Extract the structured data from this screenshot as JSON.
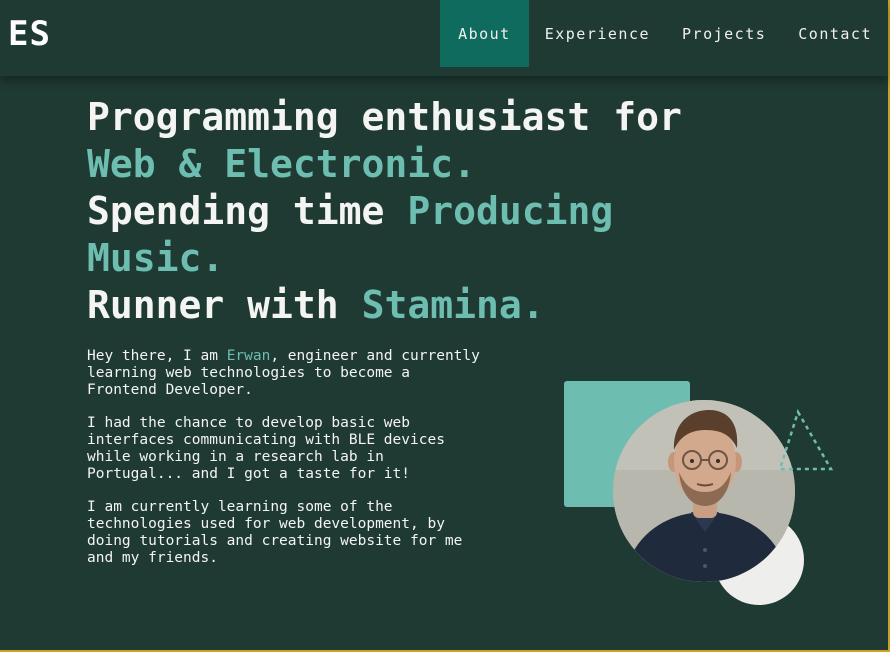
{
  "header": {
    "logo": "ES",
    "nav": [
      {
        "label": "About",
        "active": true
      },
      {
        "label": "Experience",
        "active": false
      },
      {
        "label": "Projects",
        "active": false
      },
      {
        "label": "Contact",
        "active": false
      }
    ]
  },
  "hero": {
    "line1": "Programming enthusiast for",
    "line2_accent": "Web & Electronic.",
    "line3_plain": "Spending time",
    "line3_accent": "Producing",
    "line4_accent": "Music.",
    "line5_plain": "Runner with",
    "line5_accent": "Stamina."
  },
  "intro": {
    "p1_before": "Hey there, I am",
    "p1_name": "Erwan",
    "p1_after": ", engineer and currently learning web technologies to become a Frontend Developer.",
    "p2": "I had the chance to develop basic web interfaces communicating with BLE devices while working in a research lab in Portugal... and I got a taste for it!",
    "p3": "I am currently learning some of the technologies used for web development, by doing tutorials and creating website for me and my friends."
  },
  "colors": {
    "background": "#1f3a33",
    "accent": "#6dbdb0",
    "nav_active": "#0f6b5e",
    "text": "#f4f4f2"
  },
  "icons": [
    "triangle-outline-icon"
  ]
}
